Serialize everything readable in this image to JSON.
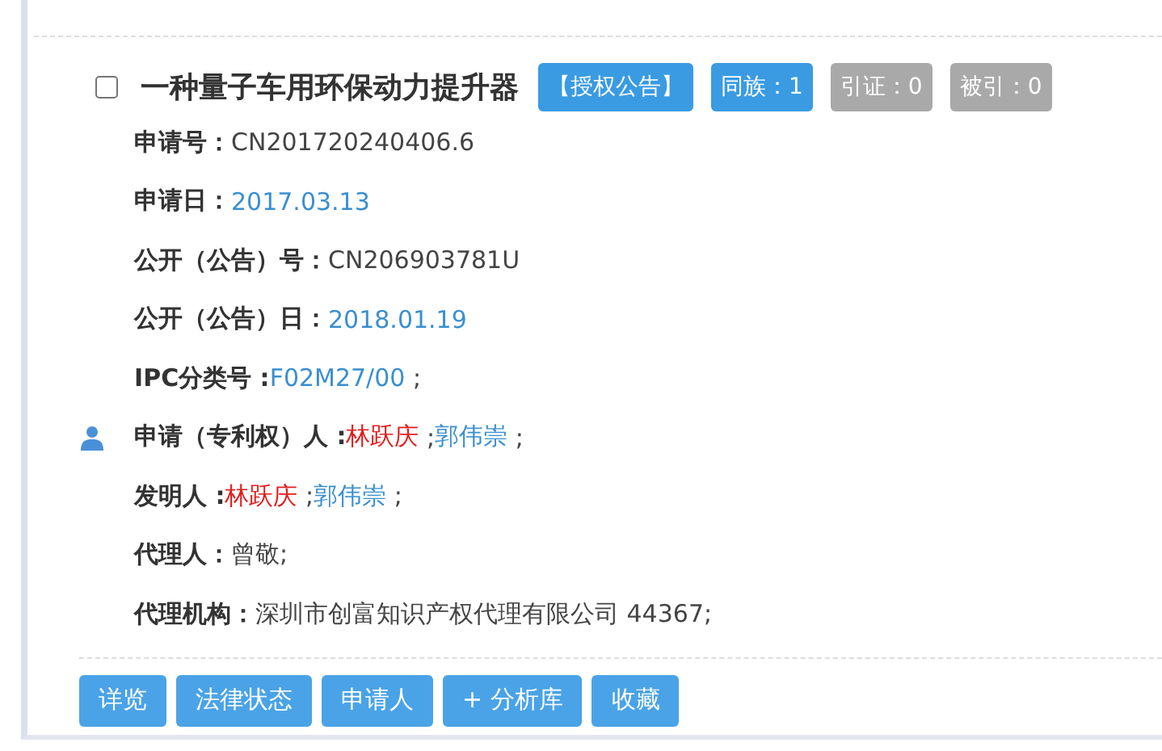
{
  "record": {
    "checked": false,
    "title": "一种量子车用环保动力提升器",
    "badges": [
      {
        "label": "【授权公告】",
        "active": true
      },
      {
        "label": "同族：1",
        "active": true
      },
      {
        "label": "引证：0",
        "active": false
      },
      {
        "label": "被引：0",
        "active": false
      }
    ],
    "fields": [
      {
        "kind": "plain",
        "label": "申请号：",
        "values": [
          {
            "text": "CN201720240406.6",
            "color": "#444444"
          }
        ]
      },
      {
        "kind": "plain",
        "label": "申请日：",
        "values": [
          {
            "text": "2017.03.13",
            "color": "#3a8fd0"
          }
        ]
      },
      {
        "kind": "plain",
        "label": "公开（公告）号：",
        "values": [
          {
            "text": "CN206903781U",
            "color": "#444444"
          }
        ]
      },
      {
        "kind": "plain",
        "label": "公开（公告）日：",
        "values": [
          {
            "text": "2018.01.19",
            "color": "#3a8fd0"
          }
        ]
      },
      {
        "kind": "plain",
        "label": "IPC分类号 :",
        "values": [
          {
            "text": "F02M27/00",
            "color": "#3a8fd0"
          },
          {
            "text": " ;",
            "color": "#444444"
          }
        ]
      },
      {
        "kind": "person",
        "label": "申请（专利权）人 :",
        "values": [
          {
            "text": "林跃庆",
            "color": "#e02020"
          },
          {
            "text": " ;",
            "color": "#444444"
          },
          {
            "text": "郭伟崇",
            "color": "#3a8fd0"
          },
          {
            "text": " ;",
            "color": "#444444"
          }
        ]
      },
      {
        "kind": "plain",
        "label": "发明人 :",
        "values": [
          {
            "text": "林跃庆",
            "color": "#e02020"
          },
          {
            "text": " ;",
            "color": "#444444"
          },
          {
            "text": "郭伟崇",
            "color": "#3a8fd0"
          },
          {
            "text": " ;",
            "color": "#444444"
          }
        ]
      },
      {
        "kind": "plain",
        "label": "代理人：",
        "values": [
          {
            "text": "曾敬;",
            "color": "#444444"
          }
        ]
      },
      {
        "kind": "plain",
        "label": "代理机构：",
        "values": [
          {
            "text": "深圳市创富知识产权代理有限公司 44367;",
            "color": "#444444"
          }
        ]
      }
    ],
    "actions": [
      "详览",
      "法律状态",
      "申请人",
      "+ 分析库",
      "收藏"
    ]
  }
}
